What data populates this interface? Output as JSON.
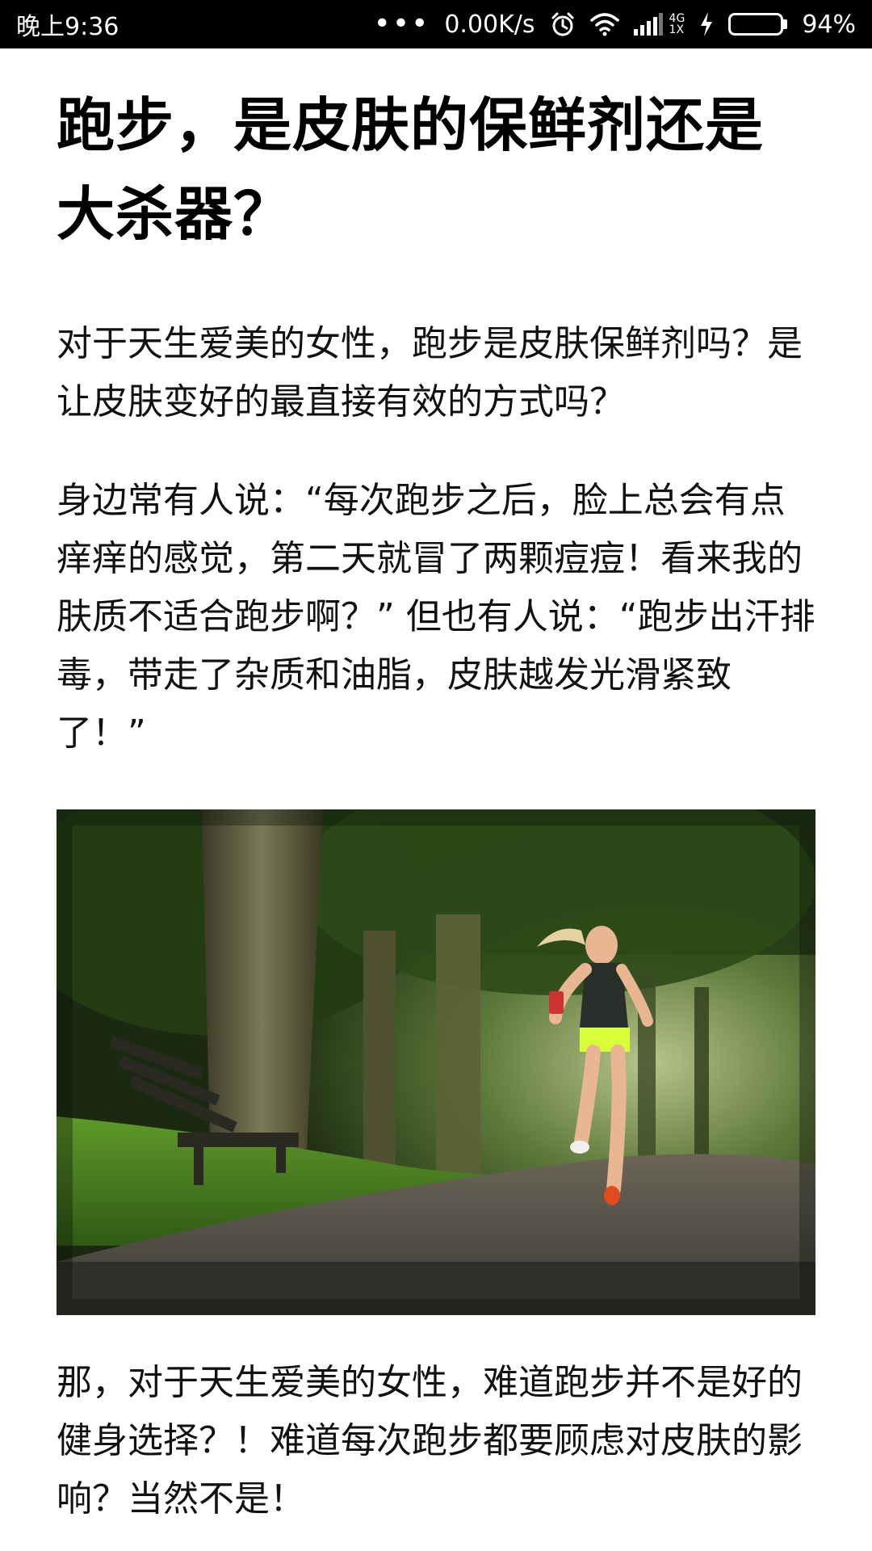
{
  "status_bar": {
    "time": "晚上9:36",
    "dots": "•••",
    "net_speed": "0.00K/s",
    "net_type_top": "4G",
    "net_type_bottom": "1X",
    "battery_percent": "94%",
    "battery_level": 0.94,
    "icons": [
      "alarm-icon",
      "wifi-icon",
      "signal-icon",
      "charging-icon",
      "battery-icon"
    ]
  },
  "article": {
    "title": "跑步，是皮肤的保鲜剂还是大杀器？",
    "paragraphs": [
      "对于天生爱美的女性，跑步是皮肤保鲜剂吗？是让皮肤变好的最直接有效的方式吗？",
      "身边常有人说：“每次跑步之后，脸上总会有点痒痒的感觉，第二天就冒了两颗痘痘！看来我的肤质不适合跑步啊？” 但也有人说：“跑步出汗排毒，带走了杂质和油脂，皮肤越发光滑紧致了！”",
      "那，对于天生爱美的女性，难道跑步并不是好的健身选择？！难道每次跑步都要顾虑对皮肤的影响？当然不是！"
    ]
  },
  "colors": {
    "status_bar_bg": "#000000",
    "battery_fill": "#55dd33",
    "text": "#111111"
  }
}
